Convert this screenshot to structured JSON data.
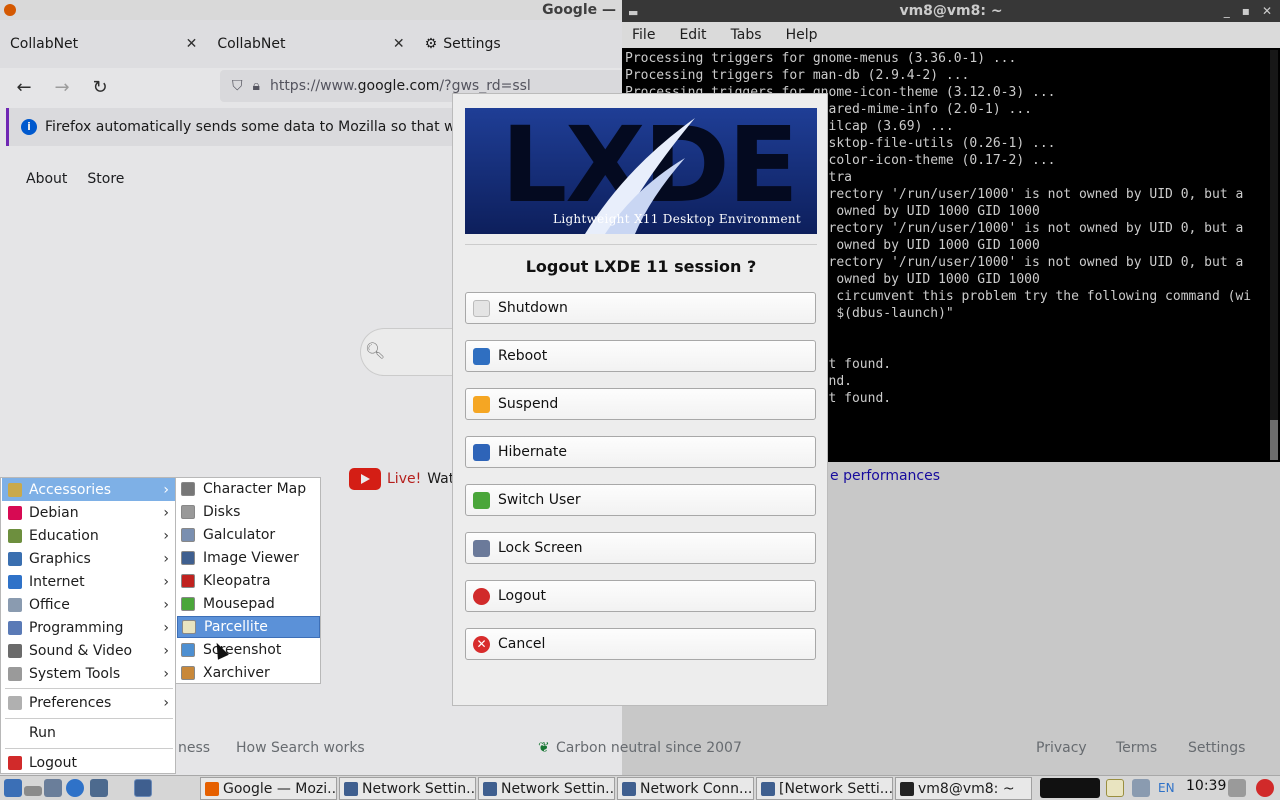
{
  "browser": {
    "window_title": "Google —",
    "tabs": [
      {
        "label": "CollabNet"
      },
      {
        "label": "CollabNet"
      },
      {
        "label": "Settings"
      }
    ],
    "url_prefix": "https://www.",
    "url_domain": "google.com",
    "url_suffix": "/?gws_rd=ssl",
    "notification": "Firefox automatically sends some data to Mozilla so that we c",
    "google_nav": {
      "about": "About",
      "store": "Store"
    },
    "yt_live": "Live!",
    "yt_watch": "Watc",
    "performances": "e performances",
    "footer": {
      "business": "ness",
      "how_search": "How Search works",
      "carbon": "Carbon neutral since 2007",
      "privacy": "Privacy",
      "terms": "Terms",
      "settings": "Settings"
    }
  },
  "terminal": {
    "title": "vm8@vm8: ~",
    "menu": [
      "File",
      "Edit",
      "Tabs",
      "Help"
    ],
    "lines": [
      "Processing triggers for gnome-menus (3.36.0-1) ...",
      "Processing triggers for man-db (2.9.4-2) ...",
      "Processing triggers for gnome-icon-theme (3.12.0-3) ...",
      "Processing triggers for shared-mime-info (2.0-1) ...",
      "Processing triggers for mailcap (3.69) ...",
      "Processing triggers for desktop-file-utils (0.26-1) ...",
      "Processing triggers for hicolor-icon-theme (0.17-2) ...",
      "                         atra",
      "                         irectory '/run/user/1000' is not owned by UID 0, but a",
      "                         0 owned by UID 1000 GID 1000",
      "                         irectory '/run/user/1000' is not owned by UID 0, but a",
      "                         0 owned by UID 1000 GID 1000",
      "                         irectory '/run/user/1000' is not owned by UID 0, but a",
      "                         0 owned by UID 1000 GID 1000",
      "                         o circumvent this problem try the following command (wi",
      "                         t $(dbus-launch)\"",
      "",
      "",
      "                         ot found.",
      "                         und.",
      "                         ot found."
    ]
  },
  "dialog": {
    "banner_logo": "LXDE",
    "banner_tagline": "Lightweight X11 Desktop Environment",
    "title": "Logout LXDE 11 session ?",
    "buttons": [
      {
        "label": "Shutdown",
        "icon": "shutdown-icon"
      },
      {
        "label": "Reboot",
        "icon": "reboot-icon"
      },
      {
        "label": "Suspend",
        "icon": "suspend-icon"
      },
      {
        "label": "Hibernate",
        "icon": "hibernate-icon"
      },
      {
        "label": "Switch User",
        "icon": "switch-user-icon"
      },
      {
        "label": "Lock Screen",
        "icon": "lock-screen-icon"
      },
      {
        "label": "Logout",
        "icon": "logout-icon"
      },
      {
        "label": "Cancel",
        "icon": "cancel-icon"
      }
    ]
  },
  "start_menu": {
    "categories": [
      {
        "label": "Accessories",
        "color": "#c9a94b"
      },
      {
        "label": "Debian",
        "color": "#d70a53"
      },
      {
        "label": "Education",
        "color": "#6d8f3e"
      },
      {
        "label": "Graphics",
        "color": "#3a6fb0"
      },
      {
        "label": "Internet",
        "color": "#2f72c8"
      },
      {
        "label": "Office",
        "color": "#8a9bb0"
      },
      {
        "label": "Programming",
        "color": "#5a7ab6"
      },
      {
        "label": "Sound & Video",
        "color": "#6b6b6b"
      },
      {
        "label": "System Tools",
        "color": "#9a9a9a"
      }
    ],
    "preferences": "Preferences",
    "run": "Run",
    "logout": "Logout",
    "highlighted": "Accessories"
  },
  "accessories_submenu": {
    "items": [
      {
        "label": "Character Map",
        "color": "#777777"
      },
      {
        "label": "Disks",
        "color": "#999999"
      },
      {
        "label": "Galculator",
        "color": "#7a8fb0"
      },
      {
        "label": "Image Viewer",
        "color": "#3f5f8f"
      },
      {
        "label": "Kleopatra",
        "color": "#c0221f"
      },
      {
        "label": "Mousepad",
        "color": "#4aa63a"
      },
      {
        "label": "Parcellite",
        "color": "#e9e4c0"
      },
      {
        "label": "Screenshot",
        "color": "#4d8fd1"
      },
      {
        "label": "Xarchiver",
        "color": "#c8883a"
      }
    ],
    "highlighted": "Parcellite"
  },
  "taskbar": {
    "tasks": [
      {
        "label": "Google — Mozi...",
        "color": "#e66000"
      },
      {
        "label": "Network Settin...",
        "color": "#3f5f8f"
      },
      {
        "label": "Network Settin...",
        "color": "#3f5f8f"
      },
      {
        "label": "Network Conn...",
        "color": "#3f5f8f"
      },
      {
        "label": "[Network Setti...",
        "color": "#3f5f8f"
      },
      {
        "label": "vm8@vm8: ~",
        "color": "#222222"
      }
    ],
    "clock": "10:39",
    "keyboard_layout": "EN"
  }
}
